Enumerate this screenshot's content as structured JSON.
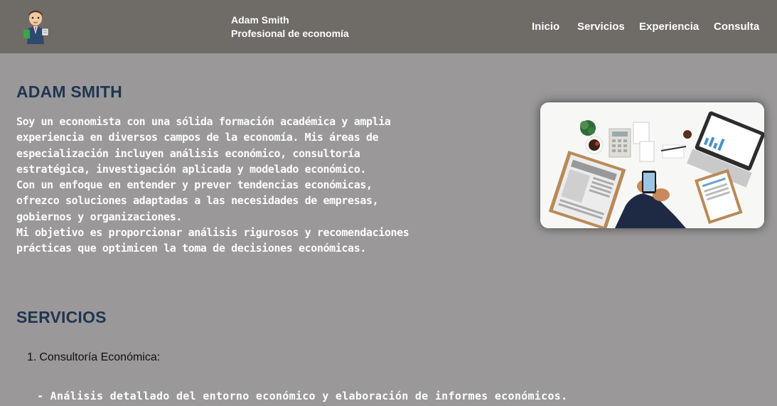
{
  "header": {
    "logo_icon": "economist-avatar-icon",
    "name": "Adam Smith",
    "role": "Profesional de economía",
    "nav": [
      {
        "label": "Inicio"
      },
      {
        "label": "Servicios"
      },
      {
        "label": "Experiencia"
      },
      {
        "label": "Consulta"
      }
    ]
  },
  "about": {
    "title": "ADAM SMITH",
    "lines": [
      "Soy un economista con una sólida formación académica y amplia",
      "experiencia en diversos campos de la economía. Mis áreas de",
      "especialización incluyen análisis económico, consultoría",
      "estratégica, investigación aplicada y modelado económico.",
      "Con un enfoque en entender y prever tendencias económicas,",
      "ofrezco soluciones adaptadas a las necesidades de empresas,",
      "gobiernos y organizaciones.",
      "Mi objetivo es proporcionar análisis rigurosos y recomendaciones",
      "prácticas que optimicen la toma de decisiones económicas."
    ],
    "photo_icon": "business-desk-photo"
  },
  "services": {
    "title": "SERVICIOS",
    "items": [
      {
        "number": "1.",
        "label": "Consultoría Económica:",
        "detail": "- Análisis detallado del entorno económico y elaboración de informes económicos."
      }
    ]
  },
  "colors": {
    "header_bg": "#6f6b67",
    "page_bg": "#9a9899",
    "heading": "#1f3550",
    "text": "#ffffff"
  }
}
